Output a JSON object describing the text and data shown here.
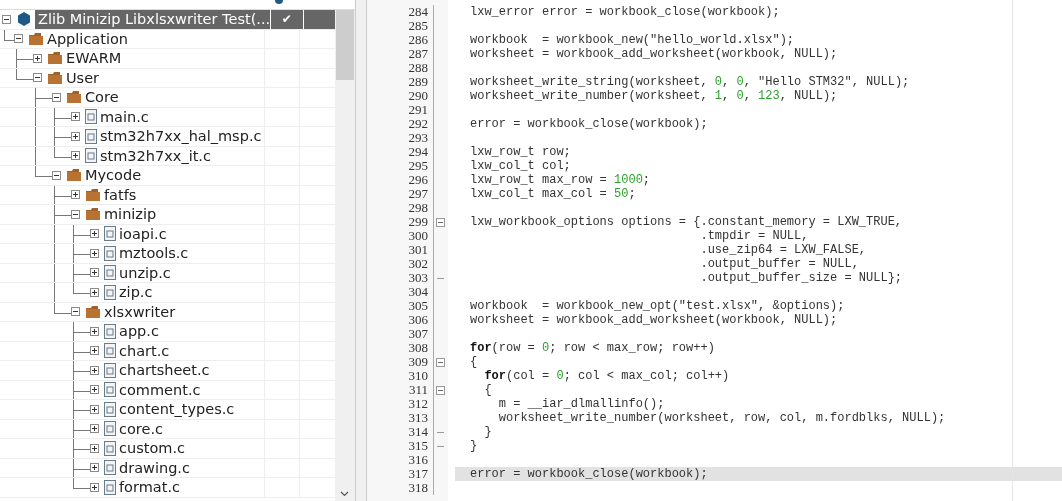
{
  "workspace": {
    "project": {
      "label": "Zlib Minizip Libxlsxwriter Test(...",
      "check": "✔",
      "selected": true,
      "expanded": true,
      "children": [
        {
          "kind": "folder",
          "label": "Application",
          "expanded": true,
          "children": [
            {
              "kind": "folder",
              "label": "EWARM",
              "expanded": false
            },
            {
              "kind": "folder",
              "label": "User",
              "expanded": true,
              "children": [
                {
                  "kind": "folder",
                  "label": "Core",
                  "expanded": true,
                  "children": [
                    {
                      "kind": "file",
                      "label": "main.c",
                      "expanded": false
                    },
                    {
                      "kind": "file",
                      "label": "stm32h7xx_hal_msp.c",
                      "expanded": false
                    },
                    {
                      "kind": "file",
                      "label": "stm32h7xx_it.c",
                      "expanded": false
                    }
                  ]
                },
                {
                  "kind": "folder",
                  "label": "Mycode",
                  "expanded": true,
                  "children": [
                    {
                      "kind": "folder",
                      "label": "fatfs",
                      "expanded": false
                    },
                    {
                      "kind": "folder",
                      "label": "minizip",
                      "expanded": true,
                      "children": [
                        {
                          "kind": "file",
                          "label": "ioapi.c",
                          "expanded": false
                        },
                        {
                          "kind": "file",
                          "label": "mztools.c",
                          "expanded": false
                        },
                        {
                          "kind": "file",
                          "label": "unzip.c",
                          "expanded": false
                        },
                        {
                          "kind": "file",
                          "label": "zip.c",
                          "expanded": false
                        }
                      ]
                    },
                    {
                      "kind": "folder",
                      "label": "xlsxwriter",
                      "expanded": true,
                      "children": [
                        {
                          "kind": "file",
                          "label": "app.c",
                          "expanded": false
                        },
                        {
                          "kind": "file",
                          "label": "chart.c",
                          "expanded": false
                        },
                        {
                          "kind": "file",
                          "label": "chartsheet.c",
                          "expanded": false
                        },
                        {
                          "kind": "file",
                          "label": "comment.c",
                          "expanded": false
                        },
                        {
                          "kind": "file",
                          "label": "content_types.c",
                          "expanded": false
                        },
                        {
                          "kind": "file",
                          "label": "core.c",
                          "expanded": false
                        },
                        {
                          "kind": "file",
                          "label": "custom.c",
                          "expanded": false
                        },
                        {
                          "kind": "file",
                          "label": "drawing.c",
                          "expanded": false
                        },
                        {
                          "kind": "file",
                          "label": "format.c",
                          "expanded": false
                        }
                      ]
                    }
                  ]
                }
              ]
            }
          ]
        }
      ]
    }
  },
  "editor": {
    "lines": [
      {
        "number": "284",
        "kind": "plain",
        "current": false,
        "tokens": [
          {
            "kind": "plain",
            "text": "lxw_error error = workbook_close(workbook);"
          }
        ]
      },
      {
        "number": "285",
        "kind": "plain"
      },
      {
        "number": "286",
        "kind": "plain",
        "current": false,
        "tokens": [
          {
            "kind": "plain",
            "text": "workbook  = workbook_new(\"hello_world.xlsx\");"
          }
        ]
      },
      {
        "number": "287",
        "kind": "plain",
        "current": false,
        "tokens": [
          {
            "kind": "plain",
            "text": "worksheet = workbook_add_worksheet(workbook, NULL);"
          }
        ]
      },
      {
        "number": "288",
        "kind": "plain"
      },
      {
        "number": "289",
        "kind": "plain",
        "current": false,
        "tokens": [
          {
            "kind": "plain",
            "text": "worksheet_write_string(worksheet, "
          },
          {
            "kind": "number",
            "text": "0"
          },
          {
            "kind": "plain",
            "text": ", "
          },
          {
            "kind": "number",
            "text": "0"
          },
          {
            "kind": "plain",
            "text": ", \"Hello STM32\", NULL);"
          }
        ]
      },
      {
        "number": "290",
        "kind": "plain",
        "current": false,
        "tokens": [
          {
            "kind": "plain",
            "text": "worksheet_write_number(worksheet, "
          },
          {
            "kind": "number",
            "text": "1"
          },
          {
            "kind": "plain",
            "text": ", "
          },
          {
            "kind": "number",
            "text": "0"
          },
          {
            "kind": "plain",
            "text": ", "
          },
          {
            "kind": "number",
            "text": "123"
          },
          {
            "kind": "plain",
            "text": ", NULL);"
          }
        ]
      },
      {
        "number": "291",
        "kind": "plain"
      },
      {
        "number": "292",
        "kind": "plain",
        "current": false,
        "tokens": [
          {
            "kind": "plain",
            "text": "error = workbook_close(workbook);"
          }
        ]
      },
      {
        "number": "293",
        "kind": "plain"
      },
      {
        "number": "294",
        "kind": "plain",
        "current": false,
        "tokens": [
          {
            "kind": "plain",
            "text": "lxw_row_t row;"
          }
        ]
      },
      {
        "number": "295",
        "kind": "plain",
        "current": false,
        "tokens": [
          {
            "kind": "plain",
            "text": "lxw_col_t col;"
          }
        ]
      },
      {
        "number": "296",
        "kind": "plain",
        "current": false,
        "tokens": [
          {
            "kind": "plain",
            "text": "lxw_row_t max_row = "
          },
          {
            "kind": "number",
            "text": "1000"
          },
          {
            "kind": "plain",
            "text": ";"
          }
        ]
      },
      {
        "number": "297",
        "kind": "plain",
        "current": false,
        "tokens": [
          {
            "kind": "plain",
            "text": "lxw_col_t max_col = "
          },
          {
            "kind": "number",
            "text": "50"
          },
          {
            "kind": "plain",
            "text": ";"
          }
        ]
      },
      {
        "number": "298",
        "kind": "plain"
      },
      {
        "number": "299",
        "kind": "fold_start",
        "current": false,
        "tokens": [
          {
            "kind": "plain",
            "text": "lxw_workbook_options options = {.constant_memory = LXW_TRUE,"
          }
        ]
      },
      {
        "number": "300",
        "kind": "plain",
        "current": false,
        "tokens": [
          {
            "kind": "plain",
            "text": "                                .tmpdir = NULL,"
          }
        ]
      },
      {
        "number": "301",
        "kind": "plain",
        "current": false,
        "tokens": [
          {
            "kind": "plain",
            "text": "                                .use_zip64 = LXW_FALSE,"
          }
        ]
      },
      {
        "number": "302",
        "kind": "plain",
        "current": false,
        "tokens": [
          {
            "kind": "plain",
            "text": "                                .output_buffer = NULL,"
          }
        ]
      },
      {
        "number": "303",
        "kind": "fold_end",
        "current": false,
        "tokens": [
          {
            "kind": "plain",
            "text": "                                .output_buffer_size = NULL};"
          }
        ]
      },
      {
        "number": "304",
        "kind": "plain"
      },
      {
        "number": "305",
        "kind": "plain",
        "current": false,
        "tokens": [
          {
            "kind": "plain",
            "text": "workbook  = workbook_new_opt(\"test.xlsx\", &options);"
          }
        ]
      },
      {
        "number": "306",
        "kind": "plain",
        "current": false,
        "tokens": [
          {
            "kind": "plain",
            "text": "worksheet = workbook_add_worksheet(workbook, NULL);"
          }
        ]
      },
      {
        "number": "307",
        "kind": "plain"
      },
      {
        "number": "308",
        "kind": "plain",
        "current": false,
        "tokens": [
          {
            "kind": "keyword",
            "text": "for"
          },
          {
            "kind": "plain",
            "text": "(row = "
          },
          {
            "kind": "number",
            "text": "0"
          },
          {
            "kind": "plain",
            "text": "; row < max_row; row++)"
          }
        ]
      },
      {
        "number": "309",
        "kind": "fold_start",
        "current": false,
        "tokens": [
          {
            "kind": "plain",
            "text": "{"
          }
        ]
      },
      {
        "number": "310",
        "kind": "plain",
        "current": false,
        "tokens": [
          {
            "kind": "keyword",
            "text": "  for"
          },
          {
            "kind": "plain",
            "text": "(col = "
          },
          {
            "kind": "number",
            "text": "0"
          },
          {
            "kind": "plain",
            "text": "; col < max_col; col++)"
          }
        ]
      },
      {
        "number": "311",
        "kind": "fold_start",
        "current": false,
        "tokens": [
          {
            "kind": "plain",
            "text": "  {"
          }
        ]
      },
      {
        "number": "312",
        "kind": "plain",
        "current": false,
        "tokens": [
          {
            "kind": "plain",
            "text": "    m = __iar_dlmallinfo();"
          }
        ]
      },
      {
        "number": "313",
        "kind": "plain",
        "current": false,
        "tokens": [
          {
            "kind": "plain",
            "text": "    worksheet_write_number(worksheet, row, col, m.fordblks, NULL);"
          }
        ]
      },
      {
        "number": "314",
        "kind": "fold_end",
        "current": false,
        "tokens": [
          {
            "kind": "plain",
            "text": "  }"
          }
        ]
      },
      {
        "number": "315",
        "kind": "fold_end",
        "current": false,
        "tokens": [
          {
            "kind": "plain",
            "text": "}"
          }
        ]
      },
      {
        "number": "316",
        "kind": "plain"
      },
      {
        "number": "317",
        "kind": "plain",
        "current": true,
        "tokens": [
          {
            "kind": "plain",
            "text": "error = workbook_close(workbook);"
          }
        ]
      },
      {
        "number": "318",
        "kind": "plain"
      }
    ]
  }
}
